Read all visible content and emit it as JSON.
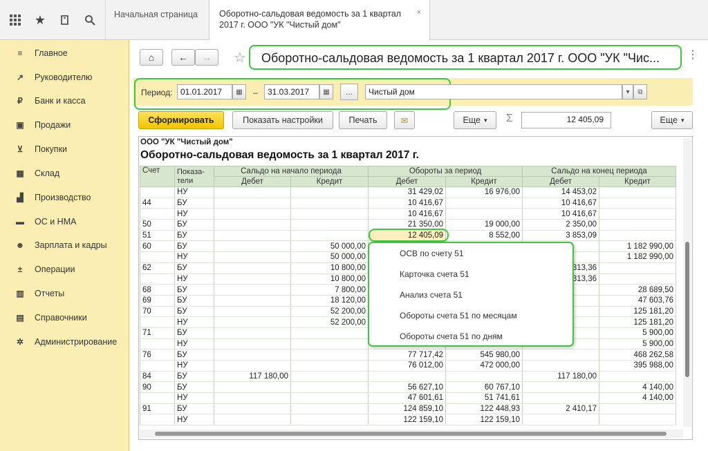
{
  "topbar": {
    "icons": [
      "apps-grid-icon",
      "star-icon",
      "history-icon",
      "search-icon"
    ],
    "tabs": [
      {
        "label": "Начальная страница"
      },
      {
        "label": "Оборотно-сальдовая ведомость за 1 квартал 2017 г. ООО \"УК \"Чистый дом\""
      }
    ],
    "close_glyph": "×"
  },
  "sidebar": {
    "items": [
      {
        "label": "Главное",
        "icon": "menu-icon"
      },
      {
        "label": "Руководителю",
        "icon": "chart-line-icon"
      },
      {
        "label": "Банк и касса",
        "icon": "ruble-icon"
      },
      {
        "label": "Продажи",
        "icon": "bag-icon"
      },
      {
        "label": "Покупки",
        "icon": "cart-icon"
      },
      {
        "label": "Склад",
        "icon": "warehouse-icon"
      },
      {
        "label": "Производство",
        "icon": "factory-icon"
      },
      {
        "label": "ОС и НМА",
        "icon": "truck-icon"
      },
      {
        "label": "Зарплата и кадры",
        "icon": "people-icon"
      },
      {
        "label": "Операции",
        "icon": "operations-icon"
      },
      {
        "label": "Отчеты",
        "icon": "bar-chart-icon"
      },
      {
        "label": "Справочники",
        "icon": "book-icon"
      },
      {
        "label": "Администрирование",
        "icon": "gear-icon"
      }
    ]
  },
  "header": {
    "title": "Оборотно-сальдовая ведомость за 1 квартал 2017 г. ООО \"УК \"Чис..."
  },
  "period": {
    "label": "Период:",
    "from": "01.01.2017",
    "dash": "–",
    "to": "31.03.2017",
    "dots": "...",
    "org": "Чистый дом"
  },
  "toolbar": {
    "form_label": "Сформировать",
    "settings_label": "Показать настройки",
    "print_label": "Печать",
    "more_label": "Еще",
    "sigma": "Σ",
    "sum_value": "12 405,09",
    "more2_label": "Еще"
  },
  "report": {
    "org": "ООО \"УК \"Чистый дом\"",
    "title": "Оборотно-сальдовая ведомость за 1 квартал 2017 г.",
    "headers": {
      "account": "Счет",
      "indicators": "Показа-\nтели",
      "opening": "Сальдо на начало периода",
      "turnover": "Обороты за период",
      "closing": "Сальдо на конец периода",
      "debit": "Дебет",
      "credit": "Кредит"
    },
    "rows": [
      [
        "",
        "НУ",
        "",
        "",
        "31 429,02",
        "16 976,00",
        "14 453,02",
        ""
      ],
      [
        "44",
        "БУ",
        "",
        "",
        "10 416,67",
        "",
        "10 416,67",
        ""
      ],
      [
        "",
        "НУ",
        "",
        "",
        "10 416,67",
        "",
        "10 416,67",
        ""
      ],
      [
        "50",
        "БУ",
        "",
        "",
        "21 350,00",
        "19 000,00",
        "2 350,00",
        ""
      ],
      [
        "51",
        "БУ",
        "",
        "",
        "12 405,09",
        "8 552,00",
        "3 853,09",
        ""
      ],
      [
        "60",
        "БУ",
        "",
        "50 000,00",
        "",
        "",
        "",
        "1 182 990,00"
      ],
      [
        "",
        "НУ",
        "",
        "50 000,00",
        "",
        "",
        "",
        "1 182 990,00"
      ],
      [
        "62",
        "БУ",
        "",
        "10 800,00",
        "",
        "",
        "313,36",
        ""
      ],
      [
        "",
        "НУ",
        "",
        "10 800,00",
        "",
        "",
        "313,36",
        ""
      ],
      [
        "68",
        "БУ",
        "",
        "7 800,00",
        "",
        "",
        "",
        "28 689,50"
      ],
      [
        "69",
        "БУ",
        "",
        "18 120,00",
        "",
        "",
        "",
        "47 603,76"
      ],
      [
        "70",
        "БУ",
        "",
        "52 200,00",
        "",
        "",
        "",
        "125 181,20"
      ],
      [
        "",
        "НУ",
        "",
        "52 200,00",
        "",
        "",
        "",
        "125 181,20"
      ],
      [
        "71",
        "БУ",
        "",
        "",
        "",
        "",
        "",
        "5 900,00"
      ],
      [
        "",
        "НУ",
        "",
        "",
        "",
        "",
        "",
        "5 900,00"
      ],
      [
        "76",
        "БУ",
        "",
        "",
        "77 717,42",
        "545 980,00",
        "",
        "468 262,58"
      ],
      [
        "",
        "НУ",
        "",
        "",
        "76 012,00",
        "472 000,00",
        "",
        "395 988,00"
      ],
      [
        "84",
        "БУ",
        "117 180,00",
        "",
        "",
        "",
        "117 180,00",
        ""
      ],
      [
        "90",
        "БУ",
        "",
        "",
        "56 627,10",
        "60 767,10",
        "",
        "4 140,00"
      ],
      [
        "",
        "НУ",
        "",
        "",
        "47 601,61",
        "51 741,61",
        "",
        "4 140,00"
      ],
      [
        "91",
        "БУ",
        "",
        "",
        "124 859,10",
        "122 448,93",
        "2 410,17",
        ""
      ],
      [
        "",
        "НУ",
        "",
        "",
        "122 159,10",
        "122 159,10",
        "",
        ""
      ]
    ]
  },
  "context_menu": {
    "items": [
      "ОСВ по счету 51",
      "Карточка счета 51",
      "Анализ счета 51",
      "Обороты счета 51 по месяцам",
      "Обороты счета 51 по дням"
    ]
  },
  "colors": {
    "sidebar_bg": "#fbeeb3",
    "highlight": "#3ec63e",
    "table_header": "#d6e6cf",
    "primary_button": "#f0c400"
  }
}
